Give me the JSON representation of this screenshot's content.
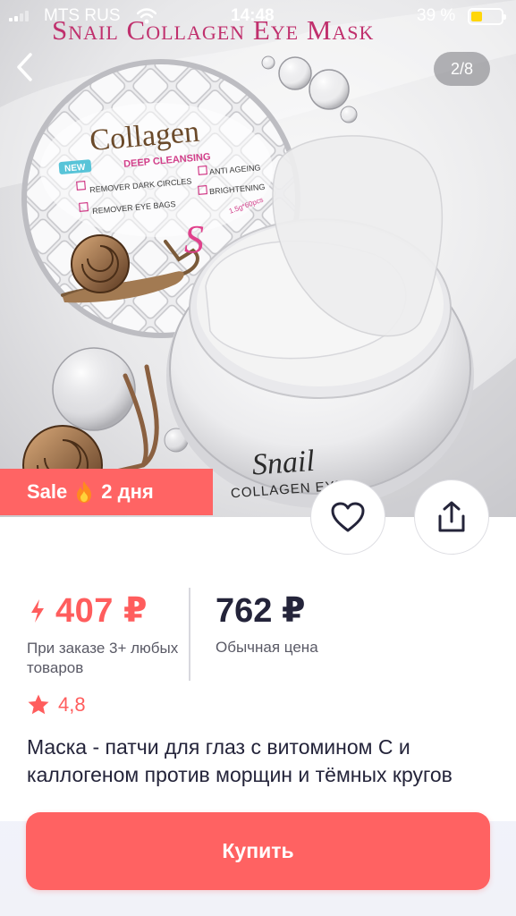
{
  "status_bar": {
    "carrier": "MTS RUS",
    "time": "14:48",
    "battery_percent": "39 %",
    "battery_level": 0.39,
    "battery_color": "#ffd60a"
  },
  "product_image": {
    "banner_text": "Snail Collagen Eye Mask",
    "lid_brand": "Collagen",
    "lid_subtitle": "DEEP CLEANSING",
    "lid_badge": "NEW",
    "lid_features": [
      "REMOVER DARK CIRCLES",
      "ANTI AGEING",
      "REMOVER EYE BAGS",
      "BRIGHTENING"
    ],
    "lid_net_weight": "1.5g*60pcs",
    "jar_brand": "Snail",
    "jar_subtitle": "COLLAGEN EYE"
  },
  "gallery": {
    "pager": "2/8"
  },
  "sale_badge": {
    "label": "Sale",
    "days": "2 дня",
    "color": "#ff6464"
  },
  "actions": {
    "favorite_icon": "heart-icon",
    "share_icon": "share-icon",
    "back_icon": "chevron-left-icon"
  },
  "price": {
    "sale_value": "407 ₽",
    "sale_note": "При заказе 3+ любых товаров",
    "regular_value": "762 ₽",
    "regular_label": "Обычная цена",
    "accent_color": "#ff5d5d"
  },
  "rating": {
    "value": "4,8"
  },
  "product_title": "Маска - патчи для глаз с витомином С и каллогеном против морщин и тёмных кругов",
  "buy_button": {
    "label": "Купить",
    "color": "#ff6262"
  }
}
